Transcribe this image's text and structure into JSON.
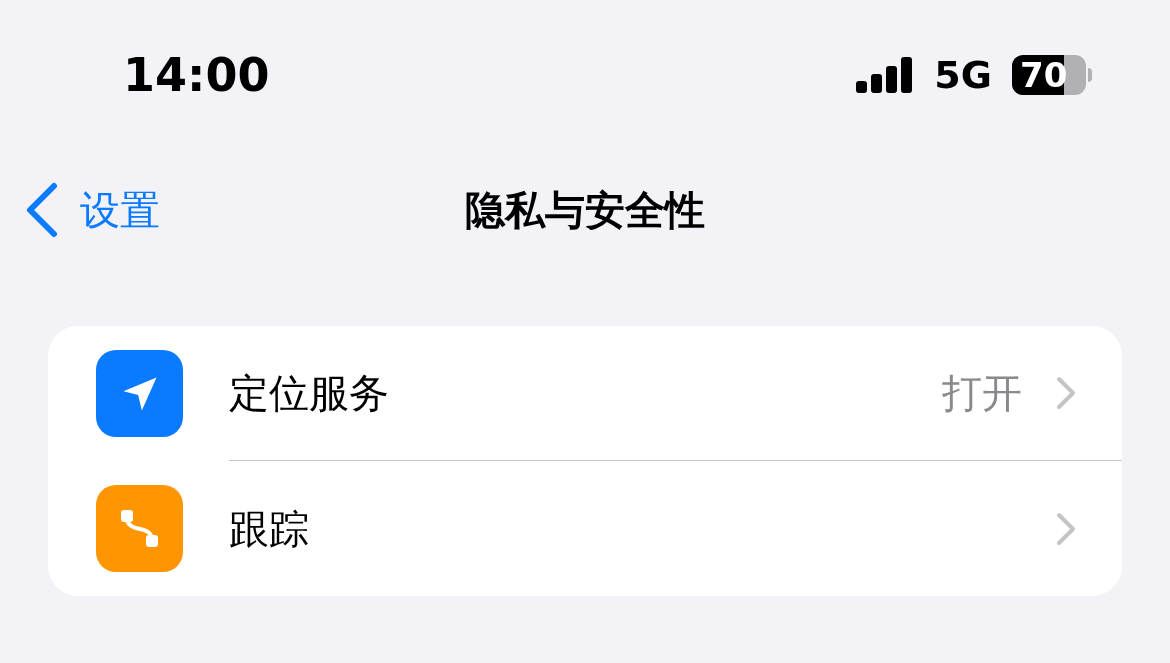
{
  "status_bar": {
    "time": "14:00",
    "network": "5G",
    "battery": "70"
  },
  "nav": {
    "back": "设置",
    "title": "隐私与安全性"
  },
  "rows": [
    {
      "kind": "location",
      "label": "定位服务",
      "value": "打开",
      "color": "#0a7aff"
    },
    {
      "kind": "tracking",
      "label": "跟踪",
      "color": "#ff9500"
    }
  ]
}
